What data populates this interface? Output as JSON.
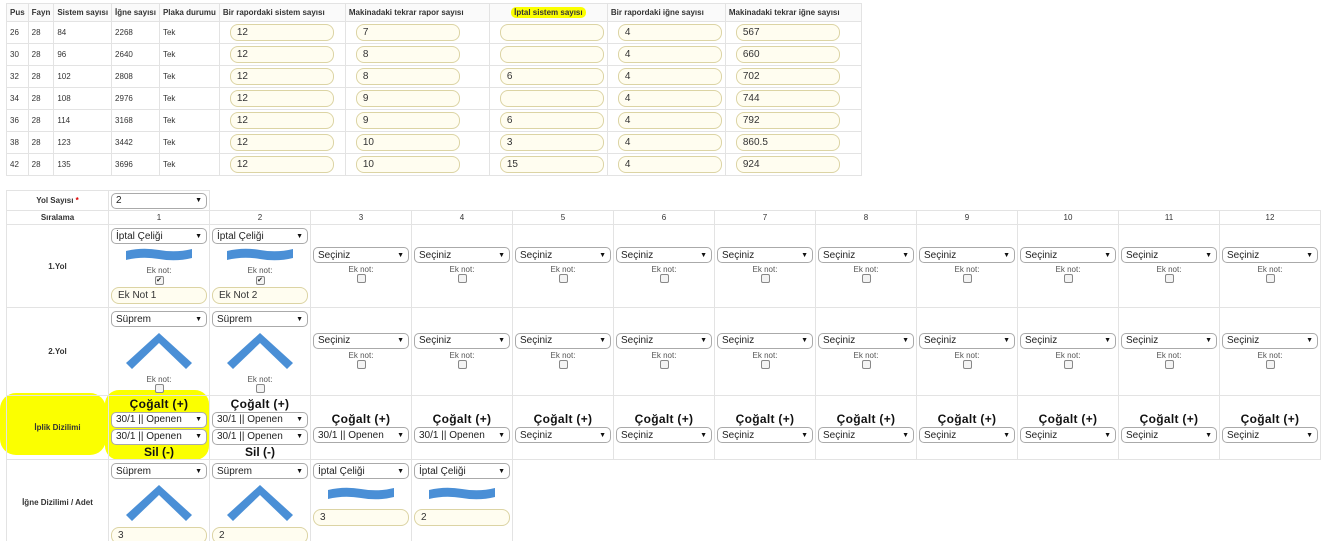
{
  "top_table": {
    "headers": [
      "Pus",
      "Fayn",
      "Sistem sayısı",
      "İğne sayısı",
      "Plaka durumu",
      "Bir rapordaki sistem sayısı",
      "Makinadaki tekrar rapor sayısı",
      "İptal sistem sayısı",
      "Bir rapordaki iğne sayısı",
      "Makinadaki tekrar iğne sayısı"
    ],
    "rows": [
      [
        "26",
        "28",
        "84",
        "2268",
        "Tek",
        "12",
        "7",
        "",
        "4",
        "567"
      ],
      [
        "30",
        "28",
        "96",
        "2640",
        "Tek",
        "12",
        "8",
        "",
        "4",
        "660"
      ],
      [
        "32",
        "28",
        "102",
        "2808",
        "Tek",
        "12",
        "8",
        "6",
        "4",
        "702"
      ],
      [
        "34",
        "28",
        "108",
        "2976",
        "Tek",
        "12",
        "9",
        "",
        "4",
        "744"
      ],
      [
        "36",
        "28",
        "114",
        "3168",
        "Tek",
        "12",
        "9",
        "6",
        "4",
        "792"
      ],
      [
        "38",
        "28",
        "123",
        "3442",
        "Tek",
        "12",
        "10",
        "3",
        "4",
        "860.5"
      ],
      [
        "42",
        "28",
        "135",
        "3696",
        "Tek",
        "12",
        "10",
        "15",
        "4",
        "924"
      ]
    ]
  },
  "grid": {
    "yol_sayisi_label": "Yol Sayısı",
    "required_mark": "*",
    "yol_sayisi_value": "2",
    "siralama_label": "Sıralama",
    "columns": [
      "1",
      "2",
      "3",
      "4",
      "5",
      "6",
      "7",
      "8",
      "9",
      "10",
      "11",
      "12"
    ],
    "row1_label": "1.Yol",
    "row2_label": "2.Yol",
    "row3_label": "İplik Dizilimi",
    "row4_label": "İğne Dizilimi / Adet",
    "ek_not_label": "Ek not:",
    "seciniz": "Seçiniz",
    "cogalt": "Çoğalt (+)",
    "sil": "Sil (-)",
    "yol1": [
      {
        "select": "İptal Çeliği",
        "note": "Ek Not 1"
      },
      {
        "select": "İptal Çeliği",
        "note": "Ek Not 2"
      }
    ],
    "yol2": [
      {
        "select": "Süprem"
      },
      {
        "select": "Süprem"
      }
    ],
    "iplik": [
      [
        "30/1 || Openen",
        "30/1 || Openen"
      ],
      [
        "30/1 || Openen",
        "30/1 || Openen"
      ],
      [
        "30/1 || Openen"
      ],
      [
        "30/1 || Openen"
      ],
      [
        "Seçiniz"
      ],
      [
        "Seçiniz"
      ],
      [
        "Seçiniz"
      ],
      [
        "Seçiniz"
      ],
      [
        "Seçiniz"
      ],
      [
        "Seçiniz"
      ],
      [
        "Seçiniz"
      ],
      [
        "Seçiniz"
      ]
    ],
    "igne": [
      {
        "select": "Süprem",
        "count": "3"
      },
      {
        "select": "Süprem",
        "count": "2"
      },
      {
        "select": "İptal Çeliği",
        "count": "3"
      },
      {
        "select": "İptal Çeliği",
        "count": "2"
      }
    ]
  },
  "colors": {
    "highlight": "#fbff00",
    "wave": "#4a8fd6"
  }
}
